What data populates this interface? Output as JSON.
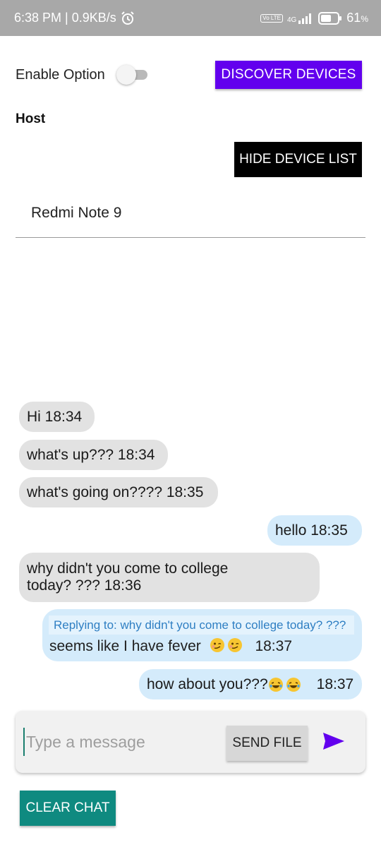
{
  "status_bar": {
    "time_speed": "6:38 PM | 0.9KB/s",
    "alarm_icon": "alarm-clock-icon",
    "volte_badge": "Vo LTE",
    "network": "4G",
    "battery_percent": "61",
    "battery_unit": "%"
  },
  "controls": {
    "enable_option_label": "Enable Option",
    "enable_option_on": false,
    "discover_label": "DISCOVER DEVICES",
    "host_label": "Host",
    "hide_list_label": "HIDE DEVICE LIST"
  },
  "device_list": [
    "Redmi Note 9"
  ],
  "messages": [
    {
      "dir": "in",
      "text": "Hi  18:34"
    },
    {
      "dir": "in",
      "text": "what's up???  18:34"
    },
    {
      "dir": "in",
      "text": "what's going on????  18:35"
    },
    {
      "dir": "out",
      "text": "hello  18:35"
    },
    {
      "dir": "in",
      "line1": "why didn't you come to college",
      "line2": "today? ???  18:36"
    },
    {
      "dir": "out",
      "reply_to": "Replying to: why didn't you come to college today? ???",
      "text_a": "seems like I have fever",
      "emoji": "woozy-face-emoji",
      "text_b": "18:37"
    },
    {
      "dir": "out",
      "text_a": "how about you???",
      "emoji": "tears-of-joy-emoji",
      "text_b": "18:37"
    }
  ],
  "composer": {
    "placeholder": "Type a message",
    "send_file_label": "SEND FILE",
    "send_icon": "send-arrow-icon"
  },
  "clear_chat_label": "CLEAR CHAT",
  "colors": {
    "discover_bg": "#6200ee",
    "clear_bg": "#0f8a80",
    "incoming_bubble": "#e2e2e2",
    "outgoing_bubble": "#d4ebfb",
    "reply_text": "#2f7fc3"
  }
}
